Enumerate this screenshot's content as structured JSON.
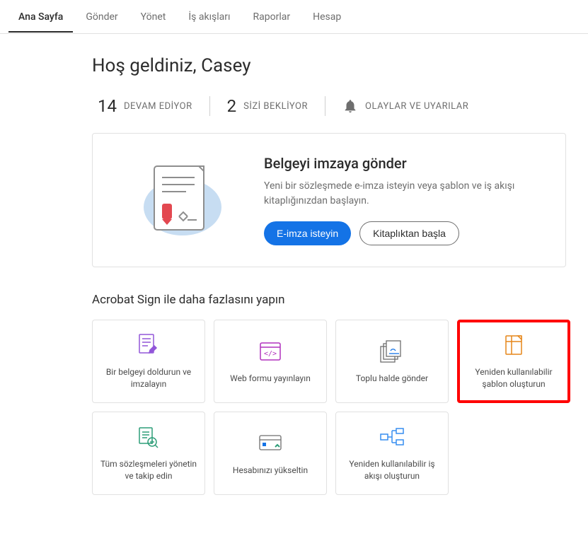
{
  "nav": {
    "tabs": [
      {
        "label": "Ana Sayfa",
        "active": true
      },
      {
        "label": "Gönder"
      },
      {
        "label": "Yönet"
      },
      {
        "label": "İş akışları"
      },
      {
        "label": "Raporlar"
      },
      {
        "label": "Hesap"
      }
    ]
  },
  "welcome": "Hoş geldiniz, Casey",
  "stats": {
    "in_progress_count": "14",
    "in_progress_label": "DEVAM EDİYOR",
    "waiting_count": "2",
    "waiting_label": "SİZİ BEKLİYOR",
    "alerts_label": "OLAYLAR VE UYARILAR"
  },
  "hero": {
    "title": "Belgeyi imzaya gönder",
    "description": "Yeni bir sözleşmede e-imza isteyin veya şablon ve iş akışı kitaplığınızdan başlayın.",
    "primary_button": "E-imza isteyin",
    "secondary_button": "Kitaplıktan başla"
  },
  "section_title": "Acrobat Sign ile daha fazlasını yapın",
  "cards": [
    {
      "label": "Bir belgeyi doldurun ve imzalayın"
    },
    {
      "label": "Web formu yayınlayın"
    },
    {
      "label": "Toplu halde gönder"
    },
    {
      "label": "Yeniden kullanılabilir şablon oluşturun",
      "highlighted": true
    },
    {
      "label": "Tüm sözleşmeleri yönetin ve takip edin"
    },
    {
      "label": "Hesabınızı yükseltin"
    },
    {
      "label": "Yeniden kullanılabilir iş akışı oluşturun"
    }
  ]
}
